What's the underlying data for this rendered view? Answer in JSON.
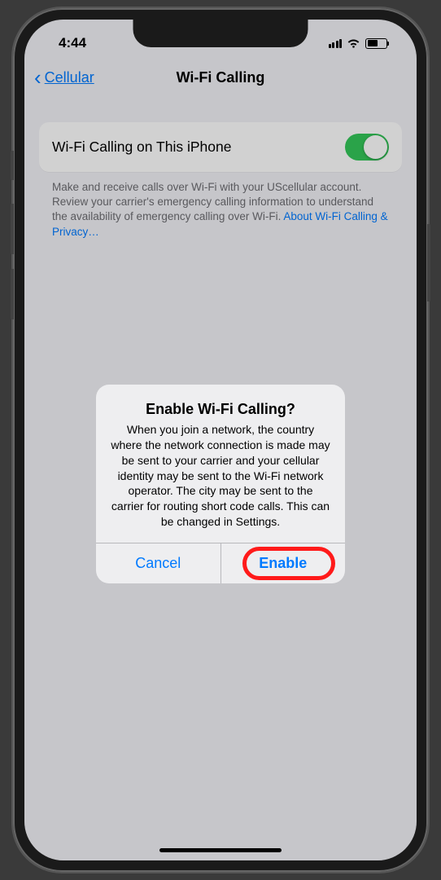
{
  "status": {
    "time": "4:44"
  },
  "nav": {
    "back_label": "Cellular",
    "title": "Wi-Fi Calling"
  },
  "setting": {
    "row_label": "Wi-Fi Calling on This iPhone",
    "footer_text": "Make and receive calls over Wi-Fi with your UScellular account. Review your carrier's emergency calling information to understand the availability of emergency calling over Wi-Fi. ",
    "footer_link": "About Wi-Fi Calling & Privacy…"
  },
  "alert": {
    "title": "Enable Wi-Fi Calling?",
    "message": "When you join a network, the country where the network connection is made may be sent to your carrier and your cellular identity may be sent to the Wi-Fi network operator. The city may be sent to the carrier for routing short code calls. This can be changed in Settings.",
    "cancel": "Cancel",
    "confirm": "Enable"
  }
}
